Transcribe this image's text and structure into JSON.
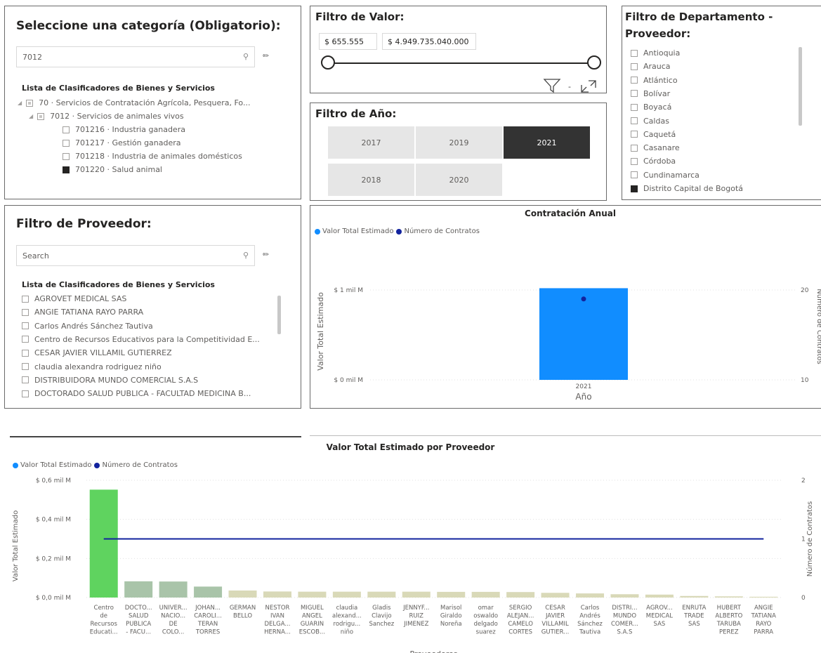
{
  "categoria": {
    "title": "Seleccione una categoría (Obligatorio):",
    "search_value": "7012",
    "list_header": "Lista de Clasificadores de Bienes y Servicios",
    "items": [
      {
        "label": "70 · Servicios de Contratación Agrícola, Pesquera, Fo...",
        "state": "partial",
        "level": 0
      },
      {
        "label": "7012 · Servicios de animales vivos",
        "state": "partial",
        "level": 1
      },
      {
        "label": "701216 · Industria ganadera",
        "state": "off",
        "level": 2
      },
      {
        "label": "701217 · Gestión ganadera",
        "state": "off",
        "level": 2
      },
      {
        "label": "701218 · Industria de animales domésticos",
        "state": "off",
        "level": 2
      },
      {
        "label": "701220 · Salud animal",
        "state": "on",
        "level": 2
      }
    ]
  },
  "valor": {
    "title": "Filtro de Valor:",
    "min": "$ 655.555",
    "max": "$ 4.949.735.040.000",
    "range_fraction": [
      0,
      1
    ]
  },
  "departamento": {
    "title_line1": "Filtro de Departamento -",
    "title_line2": "Proveedor:",
    "items": [
      {
        "label": "Antioquia",
        "checked": false
      },
      {
        "label": "Arauca",
        "checked": false
      },
      {
        "label": "Atlántico",
        "checked": false
      },
      {
        "label": "Bolívar",
        "checked": false
      },
      {
        "label": "Boyacá",
        "checked": false
      },
      {
        "label": "Caldas",
        "checked": false
      },
      {
        "label": "Caquetá",
        "checked": false
      },
      {
        "label": "Casanare",
        "checked": false
      },
      {
        "label": "Córdoba",
        "checked": false
      },
      {
        "label": "Cundinamarca",
        "checked": false
      },
      {
        "label": "Distrito Capital de Bogotá",
        "checked": true
      }
    ]
  },
  "anio": {
    "title": "Filtro de Año:",
    "years": [
      {
        "label": "2017",
        "selected": false
      },
      {
        "label": "2019",
        "selected": false
      },
      {
        "label": "2021",
        "selected": true
      },
      {
        "label": "2018",
        "selected": false
      },
      {
        "label": "2020",
        "selected": false
      }
    ]
  },
  "proveedor": {
    "title": "Filtro de Proveedor:",
    "search_placeholder": "Search",
    "list_header": "Lista de Clasificadores de Bienes y Servicios",
    "items": [
      "AGROVET MEDICAL SAS",
      "ANGIE TATIANA RAYO PARRA",
      "Carlos Andrés Sánchez Tautiva",
      "Centro de Recursos Educativos para la Competitividad E...",
      "CESAR JAVIER VILLAMIL GUTIERREZ",
      "claudia alexandra rodriguez niño",
      "DISTRIBUIDORA MUNDO COMERCIAL S.A.S",
      "DOCTORADO SALUD PUBLICA - FACULTAD MEDICINA B..."
    ]
  },
  "icons": {
    "filter": "filter-icon",
    "focus": "focus-mode-icon",
    "search": "search-icon",
    "eraser": "eraser-icon"
  },
  "colors": {
    "bar_blue": "#118dff",
    "line_navy": "#12239e",
    "bar_green": "#5fd35f",
    "bar_khaki": "#d9d9b8",
    "bar_grey_green": "#a9c4a9"
  },
  "chart_data": [
    {
      "type": "bar",
      "title": "Contratación Anual",
      "legend": [
        "Valor Total Estimado",
        "Número de Contratos"
      ],
      "legend_position": "top-left",
      "xlabel": "Año",
      "ylabel": "Valor Total Estimado",
      "y2label": "Número de Contratos",
      "categories": [
        "2021"
      ],
      "y_ticks": [
        "$ 0 mil M",
        "$ 1 mil M"
      ],
      "y2_ticks": [
        "10",
        "20"
      ],
      "ylim": [
        0,
        1
      ],
      "y2lim": [
        10,
        20
      ],
      "series": [
        {
          "name": "Valor Total Estimado",
          "kind": "bar",
          "values": [
            1.02
          ]
        },
        {
          "name": "Número de Contratos",
          "kind": "point",
          "values": [
            19
          ]
        }
      ]
    },
    {
      "type": "bar",
      "title": "Valor Total Estimado por Proveedor",
      "legend": [
        "Valor Total Estimado",
        "Número de Contratos"
      ],
      "legend_position": "top-left",
      "xlabel": "Proveedores",
      "ylabel": "Valor Total Estimado",
      "y2label": "Número de Contratos",
      "y_ticks": [
        "$ 0,0 mil M",
        "$ 0,2 mil M",
        "$ 0,4 mil M",
        "$ 0,6 mil M"
      ],
      "y2_ticks": [
        "0",
        "1",
        "2"
      ],
      "ylim": [
        0,
        0.6
      ],
      "y2lim": [
        0,
        2
      ],
      "categories": [
        [
          "Centro",
          "de",
          "Recursos",
          "Educati..."
        ],
        [
          "DOCTO...",
          "SALUD",
          "PUBLICA",
          "- FACU..."
        ],
        [
          "UNIVER...",
          "NACIO...",
          "DE",
          "COLO..."
        ],
        [
          "JOHAN...",
          "CAROLI...",
          "TERAN",
          "TORRES"
        ],
        [
          "GERMAN",
          "BELLO"
        ],
        [
          "NESTOR",
          "IVAN",
          "DELGA...",
          "HERNA..."
        ],
        [
          "MIGUEL",
          "ANGEL",
          "GUARIN",
          "ESCOB..."
        ],
        [
          "claudia",
          "alexand...",
          "rodrigu...",
          "niño"
        ],
        [
          "Gladis",
          "Clavijo",
          "Sanchez"
        ],
        [
          "JENNYF...",
          "RUIZ",
          "JIMENEZ"
        ],
        [
          "Marisol",
          "Giraldo",
          "Noreña"
        ],
        [
          "omar",
          "oswaldo",
          "delgado",
          "suarez"
        ],
        [
          "SERGIO",
          "ALEJAN...",
          "CAMELO",
          "CORTES"
        ],
        [
          "CESAR",
          "JAVIER",
          "VILLAMIL",
          "GUTIER..."
        ],
        [
          "Carlos",
          "Andrés",
          "Sánchez",
          "Tautiva"
        ],
        [
          "DISTRI...",
          "MUNDO",
          "COMER...",
          "S.A.S"
        ],
        [
          "AGROV...",
          "MEDICAL",
          "SAS"
        ],
        [
          "ENRUTA",
          "TRADE",
          "SAS"
        ],
        [
          "HUBERT",
          "ALBERTO",
          "TARUBA",
          "PEREZ"
        ],
        [
          "ANGIE",
          "TATIANA",
          "RAYO",
          "PARRA"
        ]
      ],
      "series": [
        {
          "name": "Valor Total Estimado",
          "kind": "bar",
          "values": [
            0.552,
            0.083,
            0.082,
            0.056,
            0.036,
            0.031,
            0.03,
            0.03,
            0.03,
            0.03,
            0.029,
            0.029,
            0.028,
            0.024,
            0.021,
            0.017,
            0.015,
            0.008,
            0.006,
            0.004
          ]
        },
        {
          "name": "Número de Contratos",
          "kind": "line",
          "values": [
            1,
            1,
            1,
            1,
            1,
            1,
            1,
            1,
            1,
            1,
            1,
            1,
            1,
            1,
            1,
            1,
            1,
            1,
            1,
            1
          ]
        }
      ]
    }
  ]
}
